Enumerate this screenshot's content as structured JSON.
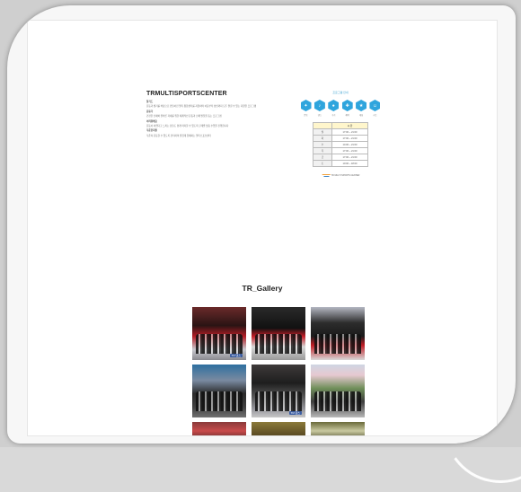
{
  "about": {
    "title": "TRMULTISPORTSCENTER",
    "paragraphs": [
      {
        "heading": "할기드",
        "text": "운동과 생기를 바탕으로 만들어진 멀티 종합센터를 지향하며 아동부터 성인까지 모두 즐길 수 있는 다양한 프로그램"
      },
      {
        "heading": "운동다",
        "text": "건강한 신체와 올바른 자세를 위한 체계적인 운동과 신체 발달을 돕는 프로그램"
      },
      {
        "heading": "어려워해요",
        "text": "운동이 어렵다고 느끼는 분들도 쉽게 따라할 수 있도록 단계별 맞춤 수업을 진행합니다"
      },
      {
        "heading": "꾸준한지원",
        "text": "꾸준히 운동할 수 있도록 관리하며 즐겁게 함께하는 멀티스포츠센터"
      }
    ]
  },
  "info": {
    "title": "프로그램 안내",
    "icons": [
      {
        "name": "running-icon",
        "glyph": "✦",
        "label": "운동"
      },
      {
        "name": "dance-icon",
        "glyph": "♪",
        "label": "댄스"
      },
      {
        "name": "ball-icon",
        "glyph": "●",
        "label": "구기"
      },
      {
        "name": "fitness-icon",
        "glyph": "✚",
        "label": "체력"
      },
      {
        "name": "trophy-icon",
        "glyph": "★",
        "label": "대회"
      },
      {
        "name": "kids-icon",
        "glyph": "☺",
        "label": "키즈"
      }
    ],
    "table": {
      "header": "시 간",
      "rows": [
        {
          "day": "월",
          "time": "17:00 ~ 21:00"
        },
        {
          "day": "화",
          "time": "17:00 ~ 21:00"
        },
        {
          "day": "수",
          "time": "14:00 ~ 21:00"
        },
        {
          "day": "목",
          "time": "17:00 ~ 21:00"
        },
        {
          "day": "금",
          "time": "17:00 ~ 21:00"
        },
        {
          "day": "토",
          "time": "10:00 ~ 18:00"
        }
      ]
    },
    "logo_text": "TR MULTI SPORTS CENTER"
  },
  "gallery": {
    "title": "TR_Gallery",
    "photos": [
      {
        "caption": "TR 댄스"
      },
      {
        "caption": ""
      },
      {
        "caption": ""
      },
      {
        "caption": ""
      },
      {
        "caption": "TR 댄스"
      },
      {
        "caption": ""
      },
      {
        "caption": ""
      },
      {
        "caption": ""
      },
      {
        "caption": ""
      }
    ]
  }
}
